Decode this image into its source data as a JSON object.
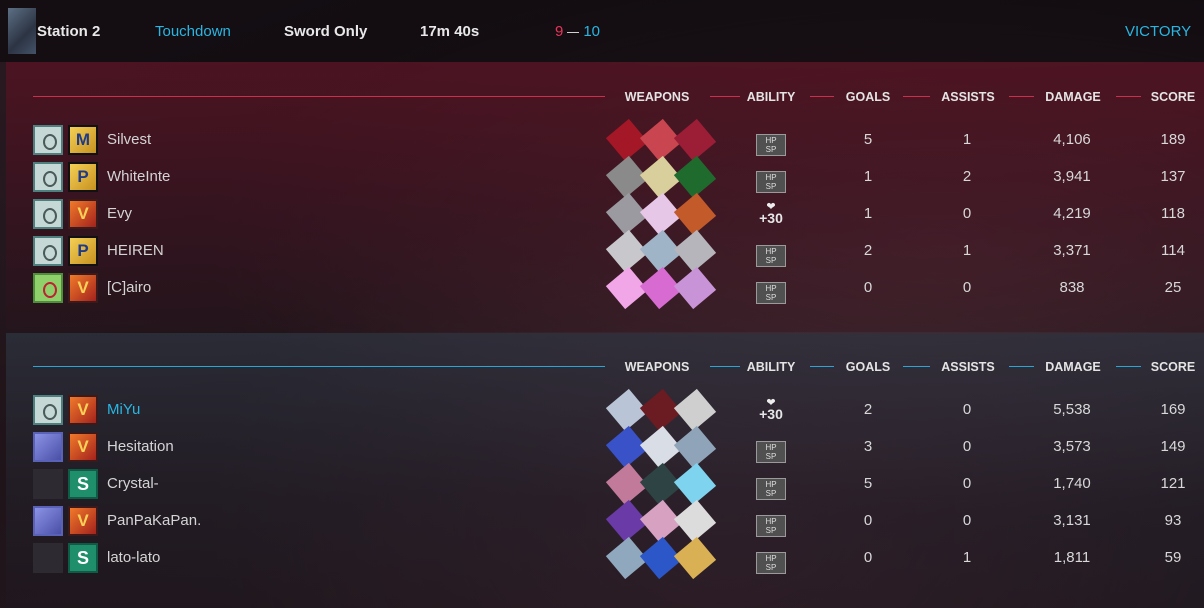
{
  "header": {
    "map": "Station 2",
    "mode": "Touchdown",
    "rule": "Sword Only",
    "time": "17m 40s",
    "score_left": "9",
    "score_right": "10",
    "result": "VICTORY"
  },
  "columns": {
    "weapons": "WEAPONS",
    "ability": "ABILITY",
    "goals": "GOALS",
    "assists": "ASSISTS",
    "damage": "DAMAGE",
    "score": "SCORE"
  },
  "ability_labels": {
    "hpsp": "HP SP",
    "heal": "+30"
  },
  "colors": {
    "team1": "#cc2f4c",
    "team2": "#2aa6d6",
    "accent": "#29b6e3",
    "score_red": "#e8355a"
  },
  "team1": {
    "players": [
      {
        "name": "Silvest",
        "goals": "5",
        "assists": "1",
        "damage": "4,106",
        "score": "189",
        "ability": "hpsp"
      },
      {
        "name": "WhiteInte",
        "goals": "1",
        "assists": "2",
        "damage": "3,941",
        "score": "137",
        "ability": "hpsp"
      },
      {
        "name": "Evy",
        "goals": "1",
        "assists": "0",
        "damage": "4,219",
        "score": "118",
        "ability": "heal"
      },
      {
        "name": "HEIREN",
        "goals": "2",
        "assists": "1",
        "damage": "3,371",
        "score": "114",
        "ability": "hpsp"
      },
      {
        "name": "[C]airo",
        "goals": "0",
        "assists": "0",
        "damage": "838",
        "score": "25",
        "ability": "hpsp"
      }
    ]
  },
  "team2": {
    "players": [
      {
        "name": "MiYu",
        "goals": "2",
        "assists": "0",
        "damage": "5,538",
        "score": "169",
        "ability": "heal"
      },
      {
        "name": "Hesitation",
        "goals": "3",
        "assists": "0",
        "damage": "3,573",
        "score": "149",
        "ability": "hpsp"
      },
      {
        "name": "Crystal-",
        "goals": "5",
        "assists": "0",
        "damage": "1,740",
        "score": "121",
        "ability": "hpsp"
      },
      {
        "name": "PanPaKaPan.",
        "goals": "0",
        "assists": "0",
        "damage": "3,131",
        "score": "93",
        "ability": "hpsp"
      },
      {
        "name": "lato-lato",
        "goals": "0",
        "assists": "1",
        "damage": "1,811",
        "score": "59",
        "ability": "hpsp"
      }
    ]
  }
}
